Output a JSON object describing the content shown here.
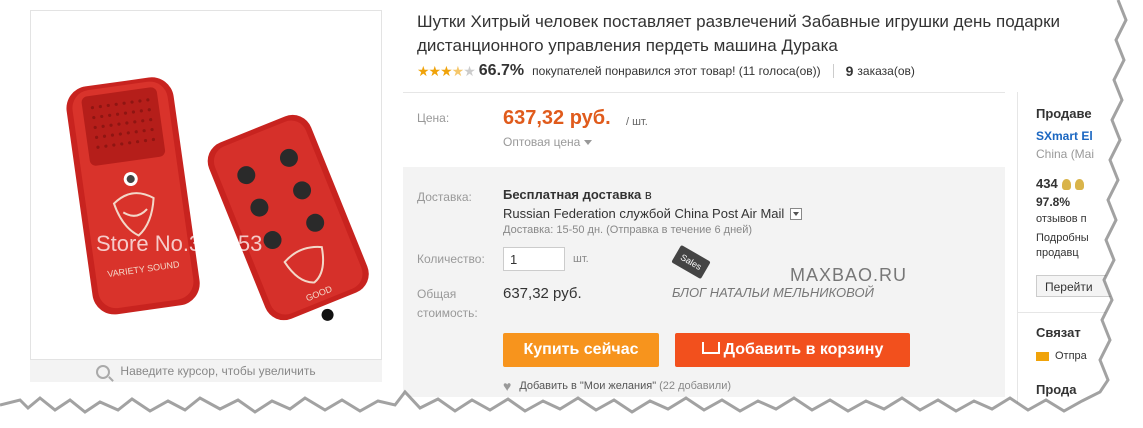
{
  "product": {
    "title": "Шутки Хитрый человек поставляет развлечений Забавные игрушки день подарки дистанционного управления пердеть машина Дурака",
    "rating_stars": 3.5,
    "rating_pct": "66.7%",
    "rating_text": "покупателей понравился этот товар! (11 голоса(ов))",
    "orders_count": "9",
    "orders_label": "заказа(ов)"
  },
  "gallery": {
    "zoom_hint": "Наведите курсор, чтобы увеличить",
    "watermark_text": "Store No.300353",
    "remote_left_text": "VARIETY SOUND",
    "remote_right_text": "GOOD",
    "under_text": "..."
  },
  "price": {
    "label": "Цена:",
    "value": "637,32 руб.",
    "unit": "/ шт.",
    "wholesale": "Оптовая цена"
  },
  "shipping": {
    "label": "Доставка:",
    "free": "Бесплатная доставка",
    "in": "в",
    "destination": "Russian Federation службой China Post Air Mail",
    "time": "Доставка: 15-50 дн. (Отправка в течение 6 дней)"
  },
  "quantity": {
    "label": "Количество:",
    "value": "1",
    "unit": "шт."
  },
  "total": {
    "label_line1": "Общая",
    "label_line2": "стоимость:",
    "value": "637,32 руб."
  },
  "actions": {
    "buy_now": "Купить сейчас",
    "add_to_cart": "Добавить в корзину",
    "wishlist": "Добавить в \"Мои желания\"",
    "wishlist_count": "(22 добавили)"
  },
  "watermark": {
    "site": "MAXBAO.RU",
    "blog": "БЛОГ НАТАЛЬИ МЕЛЬНИКОВОЙ",
    "tag": "Sales"
  },
  "seller": {
    "title": "Продаве",
    "store": "SXmart El",
    "country": "China (Mai",
    "score": "434",
    "positive": "97.8%",
    "reviews": "отзывов п",
    "details": "Подробны",
    "details2": "продавц",
    "go_button": "Перейти",
    "contact": "Связат",
    "message": "Отпра",
    "sell": "Прода"
  },
  "colors": {
    "price": "#e05b1c",
    "buy_button": "#f7941d",
    "cart_button": "#f2501d",
    "link": "#1a66c1",
    "stars": "#f0a30a"
  }
}
